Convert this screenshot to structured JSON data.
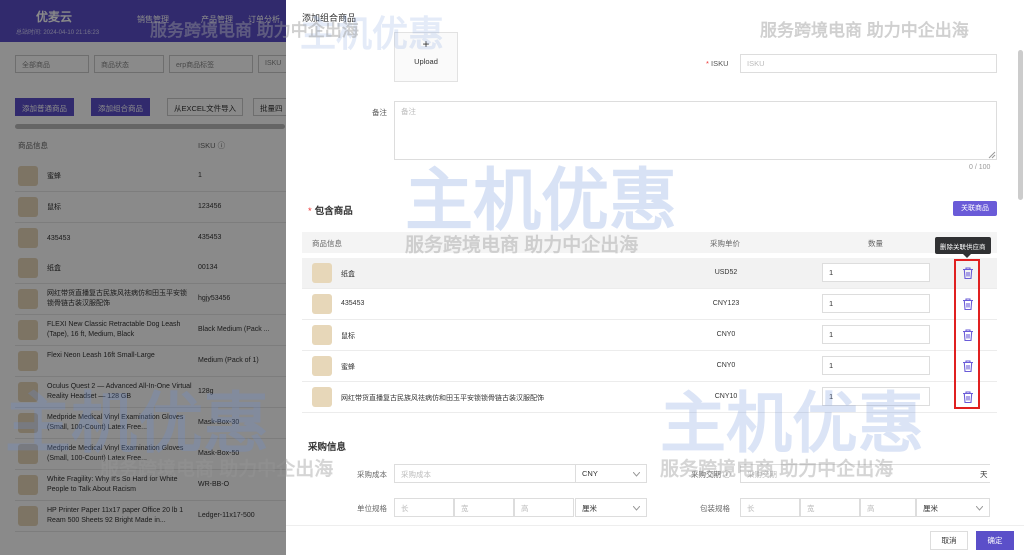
{
  "background_page": {
    "logo": "优麦云",
    "logo_sub": "总站时间: 2024-04-10 21:16:23",
    "nav": [
      "销售管理",
      "产品管理",
      "订单分析"
    ],
    "filters": [
      "全部商品",
      "商品状态",
      "erp商品标签",
      "ISKU"
    ],
    "buttons": [
      "添加普通商品",
      "添加组合商品",
      "从EXCEL文件导入",
      "批量四"
    ],
    "columns": {
      "product": "商品信息",
      "isku": "ISKU ⓘ"
    },
    "rows": [
      {
        "name": "蜜蜂",
        "isku": "1"
      },
      {
        "name": "鼠标",
        "isku": "123456"
      },
      {
        "name": "435453",
        "isku": "435453"
      },
      {
        "name": "纸盒",
        "isku": "00134"
      },
      {
        "name": "网红带货直播复古民族风祛病仿和田玉平安锁锁骨链古装汉服配饰",
        "isku": "hgjy53456"
      },
      {
        "name": "FLEXI New Classic Retractable Dog Leash (Tape), 16 ft, Medium, Black",
        "isku": "Black Medium (Pack ..."
      },
      {
        "name": "Flexi Neon Leash 16ft Small-Large",
        "isku": "Medium (Pack of 1)"
      },
      {
        "name": "Oculus Quest 2 — Advanced All-In-One Virtual Reality Headset — 128 GB",
        "isku": "128g"
      },
      {
        "name": "Medpride Medical Vinyl Examination Gloves (Small, 100-Count) Latex Free...",
        "isku": "Mask-Box-30"
      },
      {
        "name": "Medpride Medical Vinyl Examination Gloves (Small, 100-Count) Latex Free...",
        "isku": "Mask-Box-50"
      },
      {
        "name": "White Fragility: Why It's So Hard for White People to Talk About Racism",
        "isku": "WR-BB-O"
      },
      {
        "name": "HP Printer Paper 11x17 paper Office 20 lb 1 Ream 500 Sheets 92 Bright Made in...",
        "isku": "Ledger-11x17-500"
      }
    ]
  },
  "drawer": {
    "title": "添加组合商品",
    "upload": {
      "plus": "+",
      "label": "Upload"
    },
    "isku_label": "ISKU",
    "isku_required": "*",
    "isku_placeholder": "ISKU",
    "note_label": "备注",
    "note_placeholder": "备注",
    "note_counter": "0 / 100",
    "included_section": {
      "required_mark": "*",
      "title": "包含商品"
    },
    "associate_button": "关联商品",
    "table_headers": {
      "product": "商品信息",
      "price": "采购单价",
      "qty": "数量"
    },
    "tooltip": "删除关联供应商",
    "products": [
      {
        "name": "纸盒",
        "price": "USD52",
        "qty": "1"
      },
      {
        "name": "435453",
        "price": "CNY123",
        "qty": "1"
      },
      {
        "name": "鼠标",
        "price": "CNY0",
        "qty": "1"
      },
      {
        "name": "蜜蜂",
        "price": "CNY0",
        "qty": "1"
      },
      {
        "name": "网红带货直播复古民族风祛病仿和田玉平安锁锁骨链古装汉服配饰",
        "price": "CNY10",
        "qty": "1"
      }
    ],
    "purchase_section": "采购信息",
    "purchase_cost_label": "采购成本",
    "purchase_cost_placeholder": "采购成本",
    "currency": "CNY",
    "lead_time_label": "采购交期 ⓘ",
    "lead_time_placeholder": "采购交期",
    "lead_time_unit": "天",
    "unit_spec_label": "单位规格",
    "package_spec_label": "包装规格",
    "dims": {
      "length": "长",
      "width": "宽",
      "height": "高"
    },
    "dim_unit": "厘米",
    "cancel": "取消",
    "confirm": "确定"
  },
  "watermark": {
    "brand": "主机优惠",
    "slogan": "服务跨境电商  助力中企出海"
  },
  "colors": {
    "primary": "#5b4fc9",
    "danger": "#e02020",
    "watermark": "#6a8ed8"
  }
}
